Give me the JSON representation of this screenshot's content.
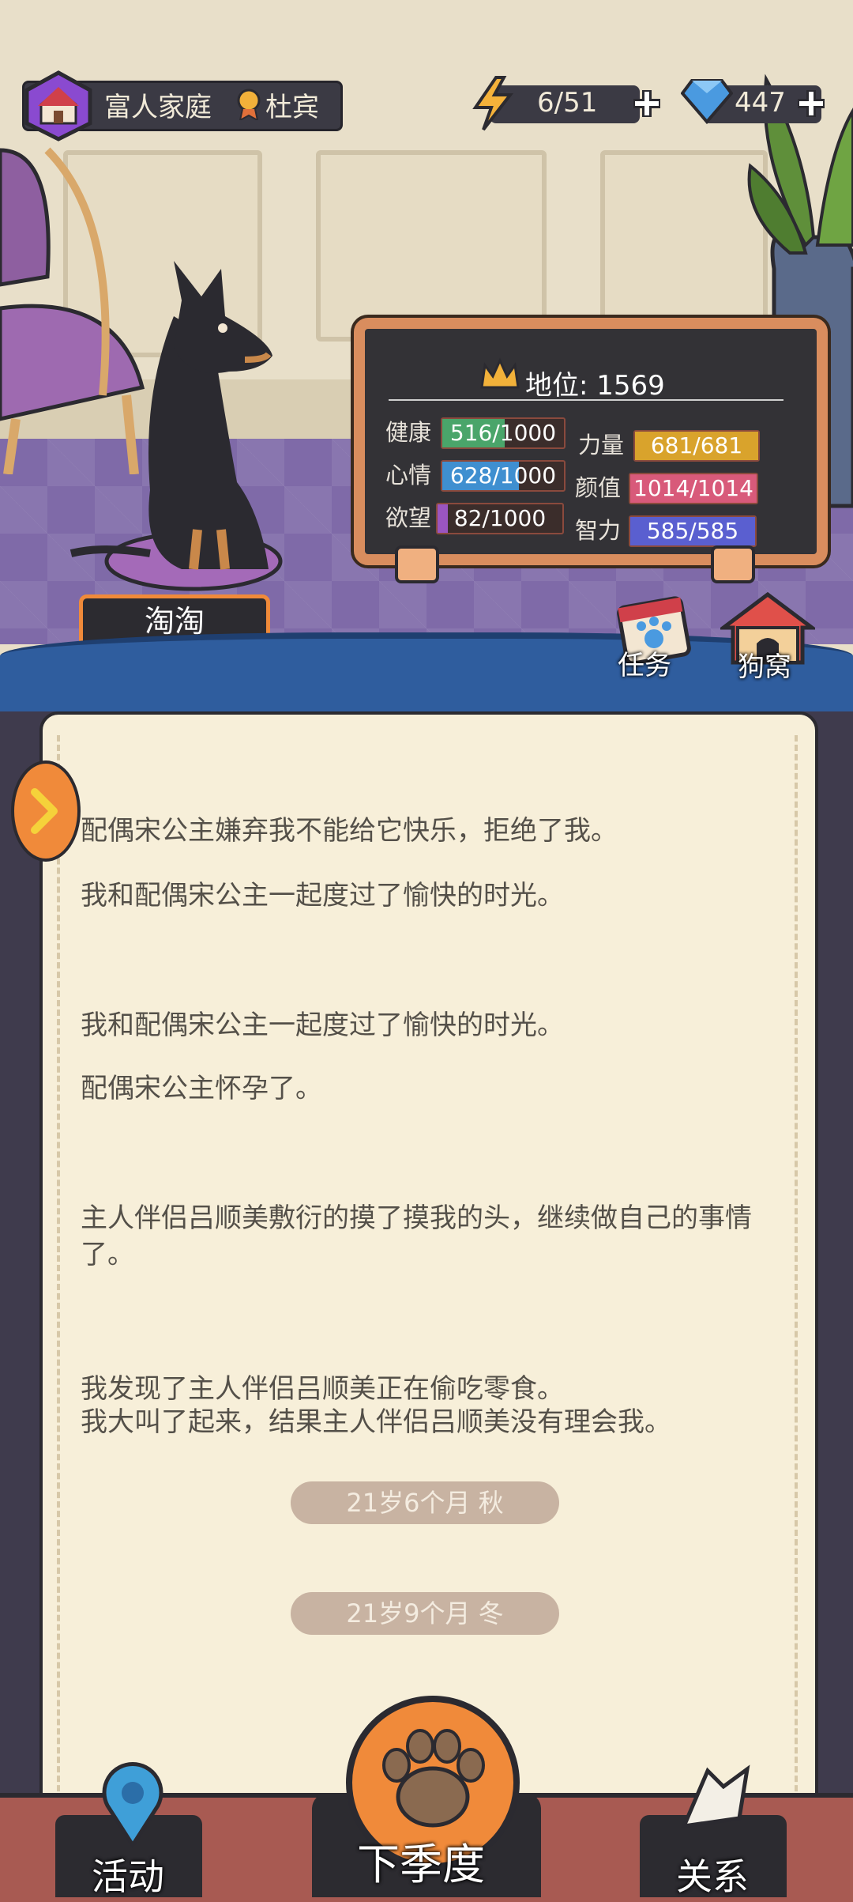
{
  "header": {
    "family_name": "富人家庭",
    "owner_name": "杜宾",
    "energy": "6/51",
    "gems": "447"
  },
  "status": {
    "title": "地位: 1569",
    "stats": [
      {
        "label": "健康",
        "value": "516/1000",
        "fraction": 0.516,
        "color": "#4aa56a"
      },
      {
        "label": "心情",
        "value": "628/1000",
        "fraction": 0.628,
        "color": "#3f8fd0"
      },
      {
        "label": "欲望",
        "value": "82/1000",
        "fraction": 0.082,
        "color": "#9a55c0"
      },
      {
        "label": "力量",
        "value": "681/681",
        "fraction": 1.0,
        "color": "#d9a32c"
      },
      {
        "label": "颜值",
        "value": "1014/1014",
        "fraction": 1.0,
        "color": "#d85a7a"
      },
      {
        "label": "智力",
        "value": "585/585",
        "fraction": 1.0,
        "color": "#5a5fd0"
      }
    ]
  },
  "pet": {
    "name": "淘淘"
  },
  "buttons": {
    "tasks": "任务",
    "doghouse": "狗窝"
  },
  "log": {
    "entries": [
      "配偶宋公主嫌弃我不能给它快乐，拒绝了我。",
      "我和配偶宋公主一起度过了愉快的时光。",
      "我和配偶宋公主一起度过了愉快的时光。",
      "配偶宋公主怀孕了。",
      "主人伴侣吕顺美敷衍的摸了摸我的头，继续做自己的事情了。",
      "我发现了主人伴侣吕顺美正在偷吃零食。",
      "我大叫了起来，结果主人伴侣吕顺美没有理会我。"
    ],
    "dates": [
      "21岁6个月 秋",
      "21岁9个月 冬"
    ]
  },
  "nav": {
    "activity": "活动",
    "next_season": "下季度",
    "relations": "关系"
  }
}
